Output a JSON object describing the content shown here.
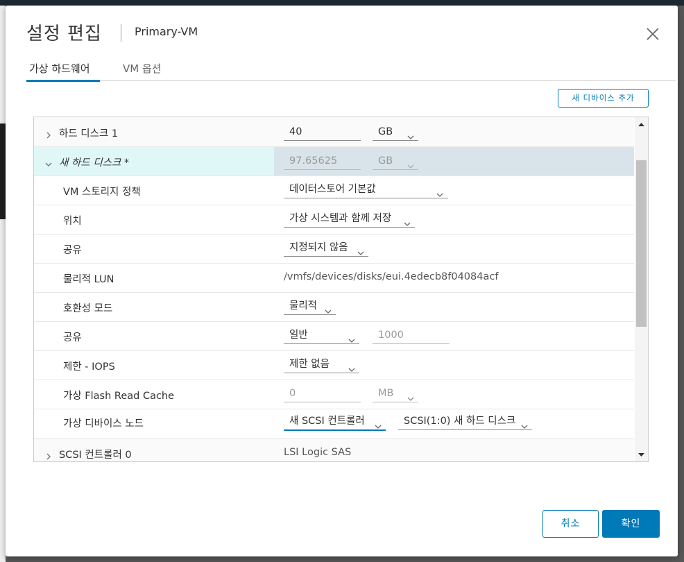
{
  "dialog": {
    "title": "설정 편집",
    "subtitle": "Primary-VM",
    "close_icon": "close-icon"
  },
  "tabs": [
    {
      "label": "가상 하드웨어",
      "active": true
    },
    {
      "label": "VM 옵션",
      "active": false
    }
  ],
  "toolbar": {
    "add_device_label": "새 디바이스 추가"
  },
  "rows": {
    "hard_disk_1": {
      "label": "하드 디스크 1",
      "size": "40",
      "unit": "GB"
    },
    "new_hard_disk": {
      "label": "새 하드 디스크 *",
      "size": "97.65625",
      "unit": "GB"
    },
    "vm_storage_policy": {
      "label": "VM 스토리지 정책",
      "value": "데이터스토어 기본값"
    },
    "location": {
      "label": "위치",
      "value": "가상 시스템과 함께 저장"
    },
    "sharing": {
      "label": "공유",
      "value": "지정되지 않음"
    },
    "physical_lun": {
      "label": "물리적 LUN",
      "value": "/vmfs/devices/disks/eui.4edecb8f04084acf"
    },
    "compat_mode": {
      "label": "호환성 모드",
      "value": "물리적"
    },
    "shares": {
      "label": "공유",
      "value": "일반",
      "number": "1000"
    },
    "limit_iops": {
      "label": "제한 - IOPS",
      "value": "제한 없음"
    },
    "flash_cache": {
      "label": "가상 Flash Read Cache",
      "value": "0",
      "unit": "MB"
    },
    "virtual_device_node": {
      "label": "가상 디바이스 노드",
      "controller": "새 SCSI 컨트롤러",
      "node": "SCSI(1:0) 새 하드 디스크"
    },
    "scsi_controller_0": {
      "label": "SCSI 컨트롤러 0",
      "value": "LSI Logic SAS"
    }
  },
  "footer": {
    "cancel_label": "취소",
    "ok_label": "확인"
  },
  "colors": {
    "accent": "#0079b8",
    "selected_row": "#d9e4ea",
    "selected_label_bg": "#e0f7f8"
  }
}
